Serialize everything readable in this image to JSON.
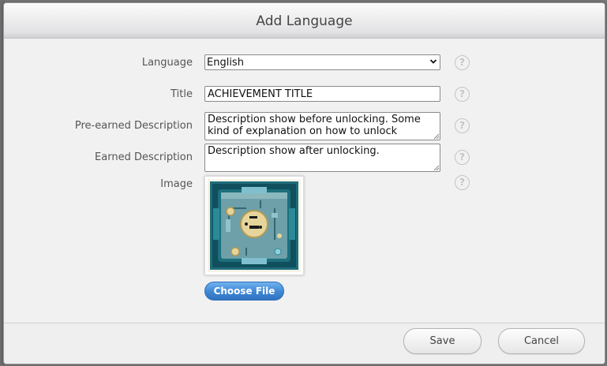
{
  "dialog": {
    "title": "Add Language"
  },
  "form": {
    "language": {
      "label": "Language",
      "value": "English"
    },
    "title": {
      "label": "Title",
      "value": "ACHIEVEMENT TITLE"
    },
    "pre_earned": {
      "label": "Pre-earned Description",
      "value": "Description show before unlocking. Some kind of explanation on how to unlock"
    },
    "earned": {
      "label": "Earned Description",
      "value": "Description show after unlocking."
    },
    "image": {
      "label": "Image",
      "choose_label": "Choose File"
    },
    "help_symbol": "?"
  },
  "footer": {
    "save_label": "Save",
    "cancel_label": "Cancel"
  },
  "colors": {
    "primary_button": "#3e86d3",
    "header_bg": "#e2e2e4",
    "dialog_bg": "#f1f1f1",
    "image_frame": "#1f6d7a"
  },
  "icons": {
    "help": "help-circle-icon",
    "dropdown": "chevron-down-icon"
  }
}
